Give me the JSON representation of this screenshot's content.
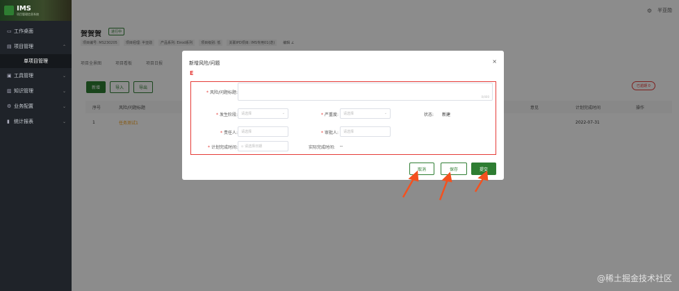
{
  "sidebar": {
    "logo_title": "IMS",
    "logo_sub": "项目管理信息系统",
    "items": [
      {
        "label": "工作桌面",
        "icon": "desktop-icon",
        "glyph": "▭",
        "chev": ""
      },
      {
        "label": "项目管理",
        "icon": "folder-icon",
        "glyph": "▤",
        "chev": "⌃"
      },
      {
        "label": "单项目管理",
        "icon": "",
        "glyph": "",
        "chev": ""
      },
      {
        "label": "工具管理",
        "icon": "toolbox-icon",
        "glyph": "▣",
        "chev": "⌄"
      },
      {
        "label": "知识管理",
        "icon": "book-icon",
        "glyph": "▥",
        "chev": "⌄"
      },
      {
        "label": "业务配置",
        "icon": "gear-icon",
        "glyph": "⚙",
        "chev": "⌄"
      },
      {
        "label": "统计报表",
        "icon": "chart-icon",
        "glyph": "▮",
        "chev": "⌄"
      }
    ]
  },
  "topbar": {
    "user": "半亚勋"
  },
  "project": {
    "title": "贺贺贺",
    "status": "进行中",
    "meta": [
      "项目编号: MS230205",
      "项目经理: 半亚勋",
      "产品系列: Eirod系列",
      "项目级别: 低",
      "关联IPD项目: IMS专用01(迭)",
      "编辑 ∠"
    ],
    "tabs": [
      "项目全景图",
      "项目看板",
      "项目日报"
    ]
  },
  "toolbar": {
    "add": "新增",
    "import": "导入",
    "export": "导出",
    "chip": "已逾期 0"
  },
  "table": {
    "headers": [
      "序号",
      "风险/问题标题",
      "意见",
      "计划完成时间",
      "操作"
    ],
    "row": {
      "index": "1",
      "title": "任务测试1",
      "planned": "2022-07-31"
    }
  },
  "modal": {
    "title": "新增风险/问题",
    "close": "×",
    "mark": "E",
    "fields": {
      "title_label": "风险/问题标题:",
      "title_counter": "0/400",
      "stage_label": "发生阶段:",
      "stage_placeholder": "请选择",
      "severity_label": "严重度:",
      "severity_placeholder": "请选择",
      "state_label": "状态:",
      "state_value": "新建",
      "owner_label": "责任人:",
      "owner_placeholder": "请选择",
      "reviewer_label": "审批人:",
      "reviewer_placeholder": "请选择",
      "plan_date_label": "计划完成时间:",
      "plan_date_placeholder": "请选择日期",
      "actual_date_label": "实际完成时间:",
      "actual_date_value": "--"
    },
    "buttons": {
      "cancel": "取消",
      "save": "保存",
      "submit": "提交"
    }
  },
  "watermark": "@稀土掘金技术社区"
}
